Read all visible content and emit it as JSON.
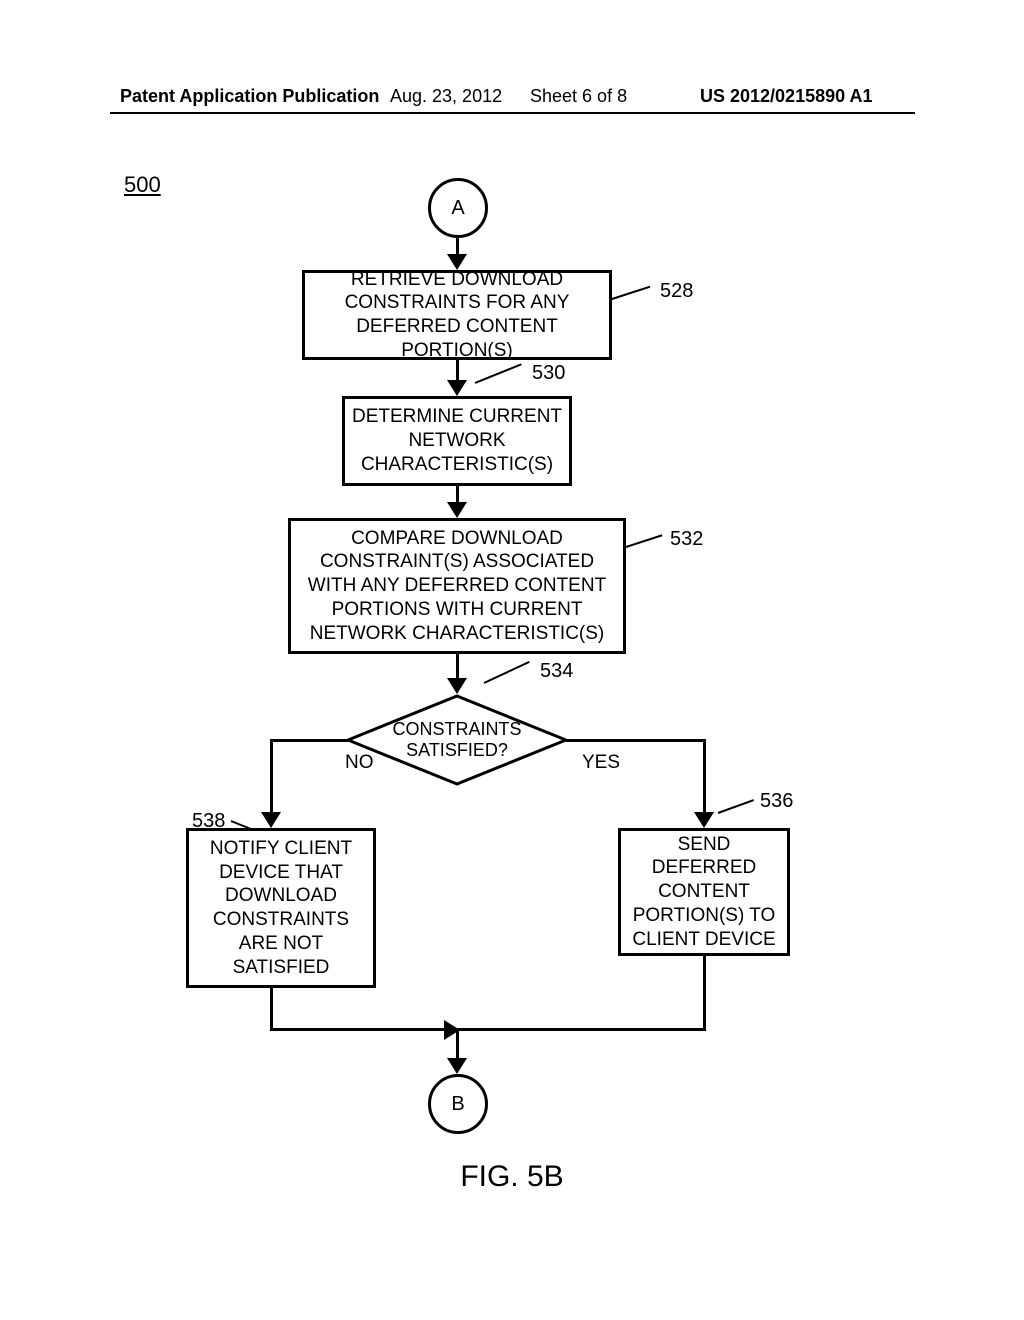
{
  "header": {
    "pub_left": "Patent Application Publication",
    "pub_date": "Aug. 23, 2012",
    "sheet": "Sheet 6 of 8",
    "pub_no": "US 2012/0215890 A1"
  },
  "figure_number": "500",
  "figure_label": "FIG. 5B",
  "nodes": {
    "A": "A",
    "B": "B",
    "step528": "RETRIEVE DOWNLOAD CONSTRAINTS FOR ANY DEFERRED CONTENT PORTION(S)",
    "step530": "DETERMINE CURRENT NETWORK CHARACTERISTIC(S)",
    "step532": "COMPARE DOWNLOAD CONSTRAINT(S) ASSOCIATED WITH ANY DEFERRED CONTENT PORTIONS WITH CURRENT NETWORK CHARACTERISTIC(S)",
    "decision534": "CONSTRAINTS SATISFIED?",
    "step536": "SEND DEFERRED CONTENT PORTION(S) TO CLIENT DEVICE",
    "step538": "NOTIFY CLIENT DEVICE THAT DOWNLOAD CONSTRAINTS ARE NOT SATISFIED"
  },
  "refs": {
    "r528": "528",
    "r530": "530",
    "r532": "532",
    "r534": "534",
    "r536": "536",
    "r538": "538"
  },
  "decision_labels": {
    "no": "NO",
    "yes": "YES"
  }
}
